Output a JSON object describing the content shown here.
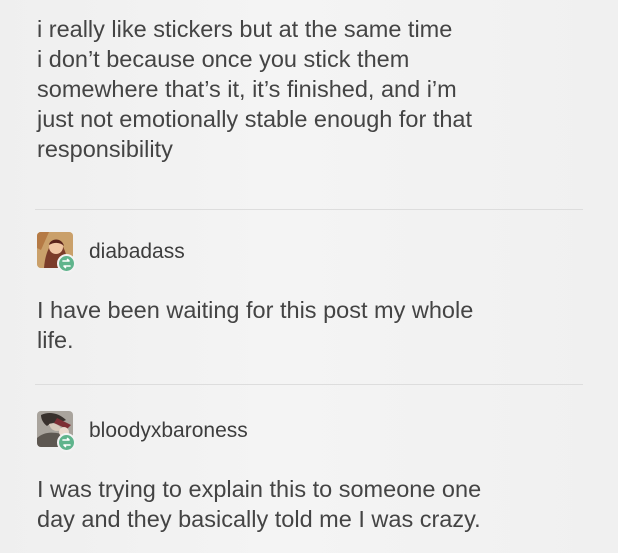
{
  "original_post": {
    "lines": [
      "i really like stickers but at the same time",
      "i don’t because once you stick them",
      "somewhere that’s it, it’s finished, and i’m",
      "just not emotionally stable enough for that",
      "responsibility"
    ]
  },
  "reblogs": [
    {
      "username": "diabadass",
      "avatar_icon": "user-avatar-icon",
      "reblog_icon": "reblog-icon",
      "lines": [
        "I have been waiting for this post my whole",
        "life."
      ]
    },
    {
      "username": "bloodyxbaroness",
      "avatar_icon": "user-avatar-icon",
      "reblog_icon": "reblog-icon",
      "lines": [
        "I was trying to explain this to someone one",
        "day and they basically told me I was crazy."
      ]
    }
  ],
  "colors": {
    "background": "#f1f1f1",
    "text": "#444444",
    "divider": "#dddddd",
    "reblog_badge": "#5fb48c"
  }
}
